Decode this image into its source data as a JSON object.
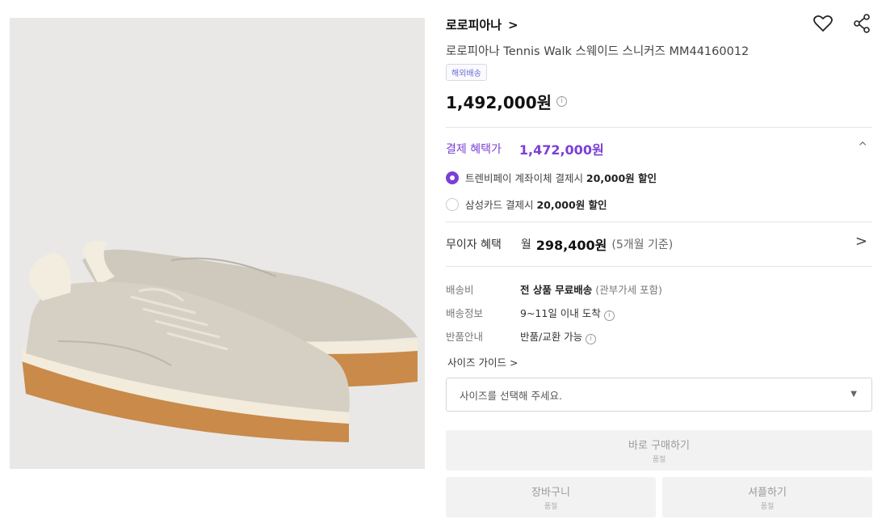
{
  "product": {
    "brand": "로로피아나",
    "brand_chevron": ">",
    "title": "로로피아나 Tennis Walk 스웨이드 스니커즈 MM44160012",
    "badge": "해외배송",
    "price": "1,492,000원",
    "price_info_icon": "i",
    "image_alt_icon": "sneaker-image"
  },
  "benefit": {
    "label": "결제 혜택가",
    "price": "1,472,000원",
    "collapse_icon": "^",
    "options": [
      {
        "text": "트렌비페이 계좌이체 결제시 ",
        "bold": "20,000원 할인",
        "selected": true
      },
      {
        "text": "삼성카드 결제시 ",
        "bold": "20,000원 할인",
        "selected": false
      }
    ]
  },
  "installment": {
    "label": "무이자 혜택",
    "prefix": "월",
    "amount": "298,400원",
    "note": "(5개월 기준)",
    "chevron": ">"
  },
  "details": [
    {
      "key": "배송비",
      "bold": "전 상품 무료배송",
      "muted": " (관부가세 포함)",
      "info": ""
    },
    {
      "key": "배송정보",
      "bold": "",
      "muted": "9~11일 이내 도착",
      "info": "i"
    },
    {
      "key": "반품안내",
      "bold": "",
      "muted": "반품/교환 가능",
      "info": "i"
    }
  ],
  "size_guide": "사이즈 가이드 >",
  "size_select": {
    "placeholder": "사이즈를 선택해 주세요.",
    "caret": "▼"
  },
  "buttons": {
    "buy_now": {
      "label": "바로 구매하기",
      "sub": "품절"
    },
    "cart": {
      "label": "장바구니",
      "sub": "품절"
    },
    "shopping": {
      "label": "셔플하기",
      "sub": "품절"
    }
  },
  "colors": {
    "accent": "#7b3fd6",
    "disabled_bg": "#f2f2f2",
    "image_bg": "#e9e8e6"
  }
}
